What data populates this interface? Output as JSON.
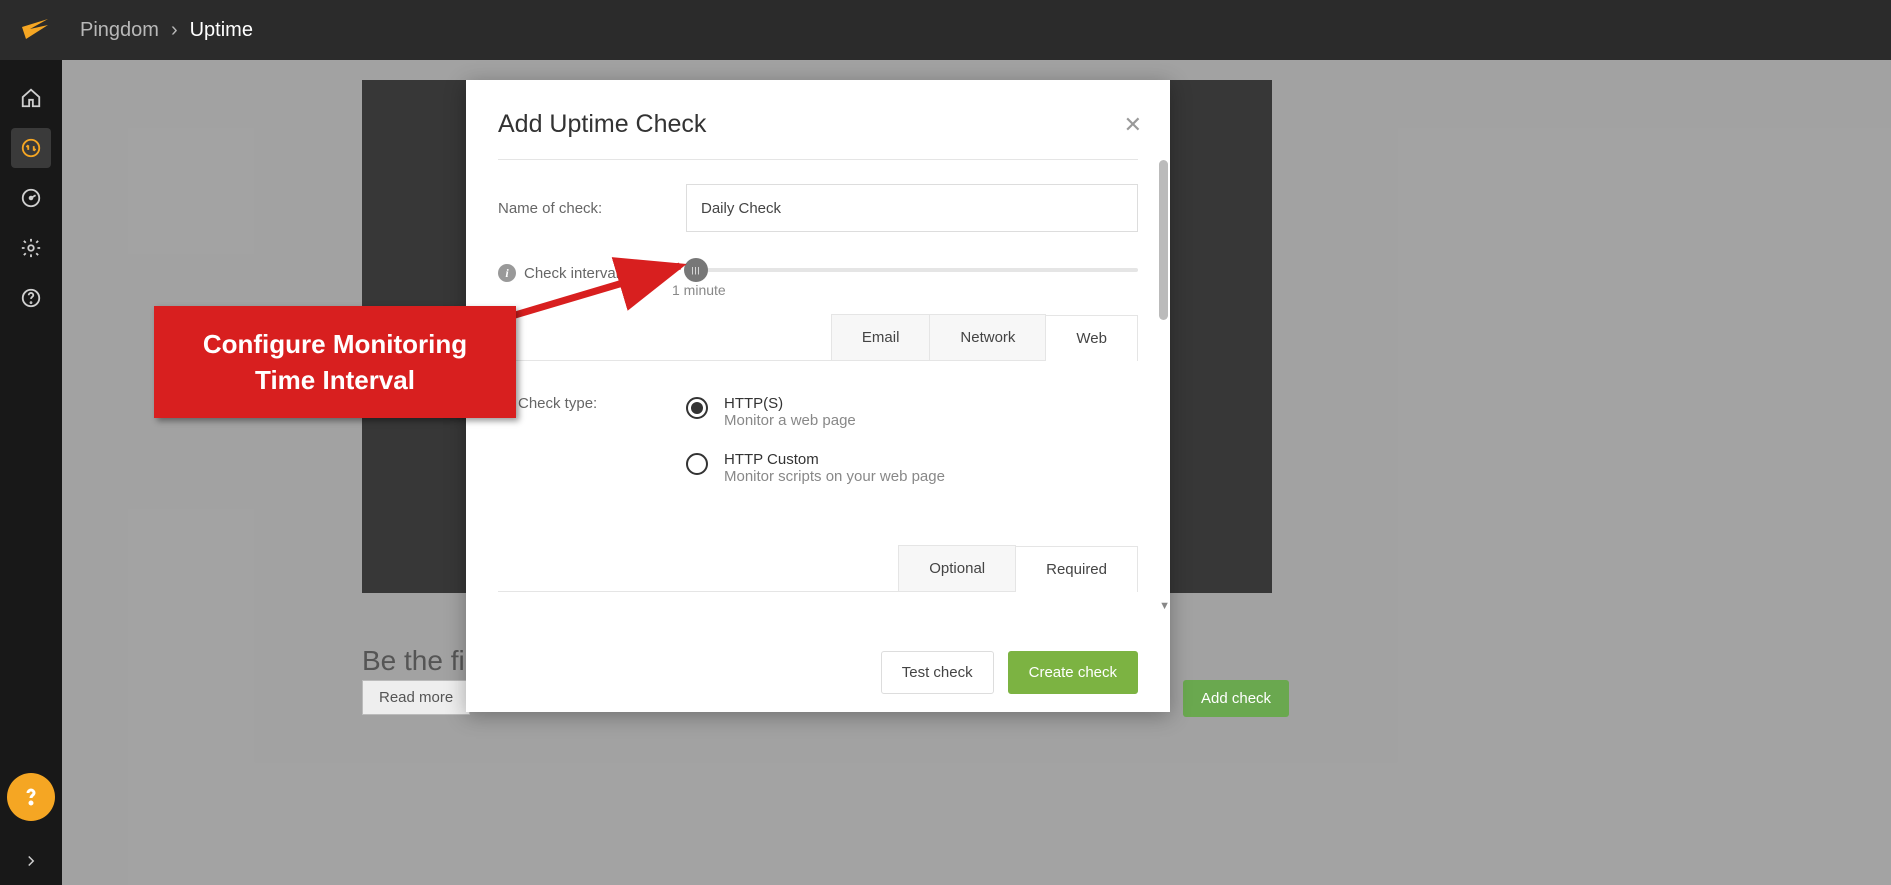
{
  "breadcrumb": {
    "root": "Pingdom",
    "current": "Uptime"
  },
  "background": {
    "be_first": "Be the fi",
    "read_more": "Read more",
    "add_check": "Add check"
  },
  "modal": {
    "title": "Add Uptime Check",
    "name_label": "Name of check:",
    "name_value": "Daily Check",
    "interval_label": "Check interval:",
    "interval_value": "1 minute",
    "tabs": {
      "email": "Email",
      "network": "Network",
      "web": "Web"
    },
    "check_type_label": "Check type:",
    "radios": {
      "https": {
        "title": "HTTP(S)",
        "sub": "Monitor a web page"
      },
      "custom": {
        "title": "HTTP Custom",
        "sub": "Monitor scripts on your web page"
      }
    },
    "tabs2": {
      "optional": "Optional",
      "required": "Required"
    },
    "footer": {
      "test": "Test check",
      "create": "Create check"
    }
  },
  "callout": {
    "line1": "Configure Monitoring",
    "line2": "Time Interval"
  }
}
